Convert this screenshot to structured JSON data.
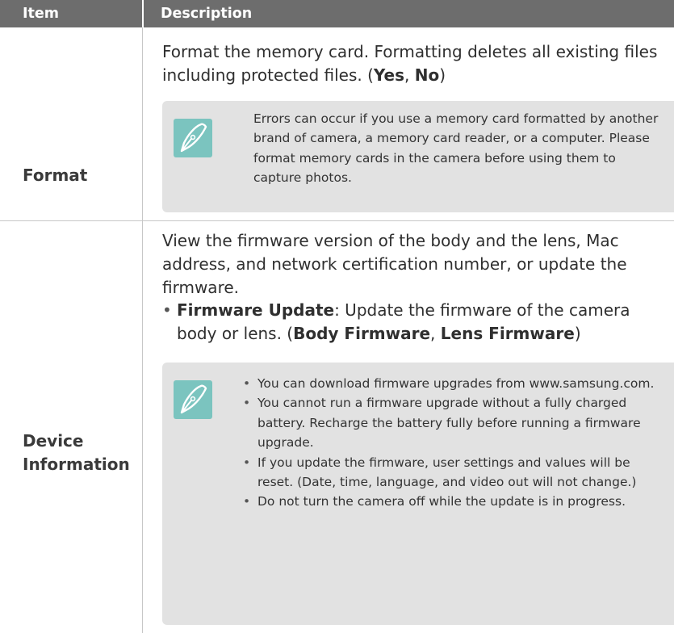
{
  "header": {
    "col_item": "Item",
    "col_description": "Description"
  },
  "rows": [
    {
      "item": "Format",
      "desc_text": "Format the memory card. Formatting deletes all existing files including protected files. (",
      "opt1": "Yes",
      "opt_sep": ", ",
      "opt2": "No",
      "desc_end": ")",
      "note": "Errors can occur if you use a memory card formatted by another brand of camera, a memory card reader, or a computer. Please format memory cards in the camera before using them to capture photos."
    },
    {
      "item_line1": "Device",
      "item_line2": "Information",
      "desc": "View the firmware version of the body and the lens, Mac address, and network certification number, or update the firmware.",
      "bullet_label": "Firmware Update",
      "bullet_text": ": Update the firmware of the camera body or lens. (",
      "bullet_opt1": "Body Firmware",
      "bullet_sep": ", ",
      "bullet_opt2": "Lens Firmware",
      "bullet_end": ")",
      "notes": [
        "You can download firmware upgrades from www.samsung.com.",
        "You cannot run a firmware upgrade without a fully charged battery. Recharge the battery fully before running a firmware upgrade.",
        "If you update the firmware, user settings and values will be reset. (Date, time, language, and video out will not change.)",
        "Do not turn the camera off while the update is in progress."
      ]
    }
  ],
  "icon_color": "#7bc4bf",
  "header_color": "#6d6d6d",
  "note_bg": "#e2e2e2"
}
